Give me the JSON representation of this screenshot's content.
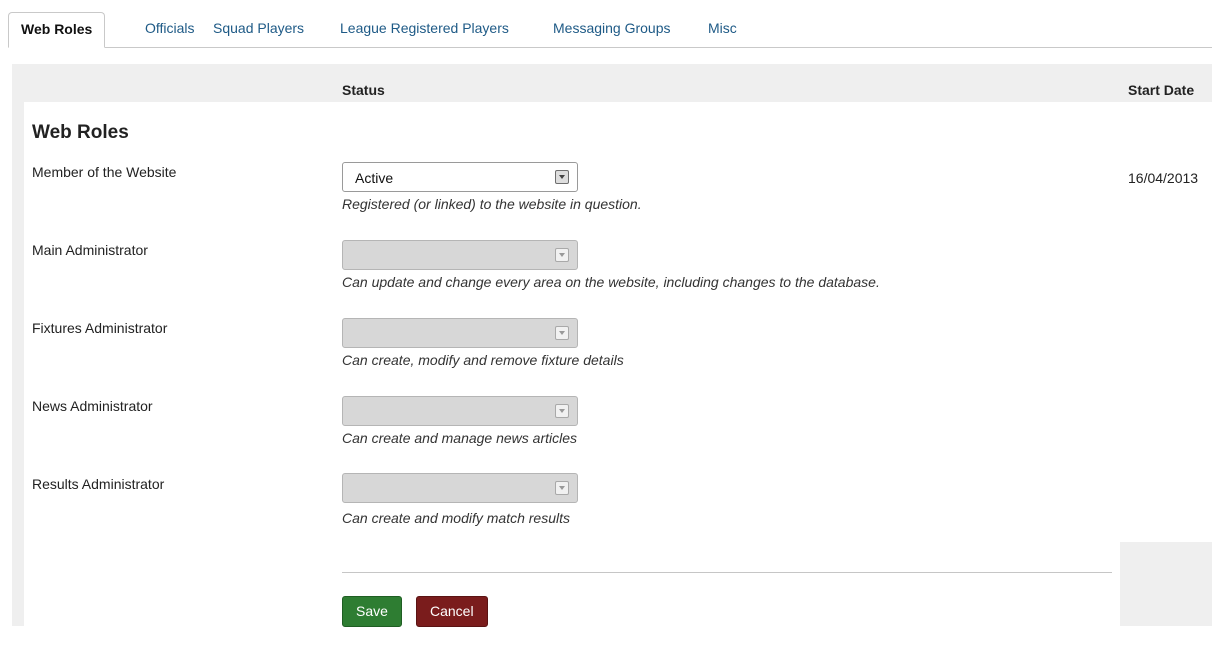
{
  "tabs": [
    "Web Roles",
    "Officials",
    "Squad Players",
    "League Registered Players",
    "Messaging Groups",
    "Misc"
  ],
  "table_headers": {
    "status": "Status",
    "start_date": "Start Date"
  },
  "section_title": "Web Roles",
  "roles": [
    {
      "label": "Member of the Website",
      "value": "Active",
      "description": "Registered (or linked) to the website in question.",
      "start_date": "16/04/2013",
      "enabled": true
    },
    {
      "label": "Main Administrator",
      "value": "",
      "description": "Can update and change every area on the website, including changes to the database.",
      "start_date": "",
      "enabled": false
    },
    {
      "label": "Fixtures Administrator",
      "value": "",
      "description": "Can create, modify and remove fixture details",
      "start_date": "",
      "enabled": false
    },
    {
      "label": "News Administrator",
      "value": "",
      "description": "Can create and manage news articles",
      "start_date": "",
      "enabled": false
    },
    {
      "label": "Results Administrator",
      "value": "",
      "description": "Can create and modify match results",
      "start_date": "",
      "enabled": false
    }
  ],
  "buttons": {
    "save": "Save",
    "cancel": "Cancel"
  },
  "colors": {
    "save": "#2e7d32",
    "cancel": "#7a1c1c",
    "tab_link": "#1e5a86",
    "panel": "#efefef"
  }
}
